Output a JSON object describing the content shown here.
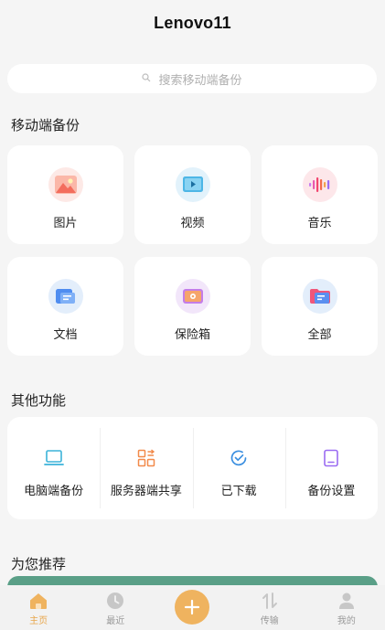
{
  "header": {
    "title": "Lenovo11"
  },
  "search": {
    "placeholder": "搜索移动端备份",
    "icon": "search-icon"
  },
  "mobile_backup": {
    "title": "移动端备份",
    "items": [
      {
        "label": "图片",
        "icon": "image-icon"
      },
      {
        "label": "视频",
        "icon": "video-icon"
      },
      {
        "label": "音乐",
        "icon": "music-icon"
      },
      {
        "label": "文档",
        "icon": "document-icon"
      },
      {
        "label": "保险箱",
        "icon": "safe-icon"
      },
      {
        "label": "全部",
        "icon": "folder-icon"
      }
    ]
  },
  "other_functions": {
    "title": "其他功能",
    "items": [
      {
        "label": "电脑端备份",
        "icon": "laptop-icon"
      },
      {
        "label": "服务器端共享",
        "icon": "server-share-icon"
      },
      {
        "label": "已下载",
        "icon": "downloaded-check-icon"
      },
      {
        "label": "备份设置",
        "icon": "backup-settings-icon"
      }
    ]
  },
  "recommend": {
    "title": "为您推荐"
  },
  "tabbar": {
    "items": [
      {
        "label": "主页",
        "icon": "home-icon",
        "active": true
      },
      {
        "label": "最近",
        "icon": "clock-icon",
        "active": false
      },
      {
        "label": "",
        "icon": "plus-icon",
        "active": false
      },
      {
        "label": "传输",
        "icon": "transfer-icon",
        "active": false
      },
      {
        "label": "我的",
        "icon": "profile-icon",
        "active": false
      }
    ]
  },
  "colors": {
    "accent": "#e8a64c",
    "fab": "#efb35f",
    "background": "#f5f5f5",
    "recommend_band": "#5a9f87"
  }
}
